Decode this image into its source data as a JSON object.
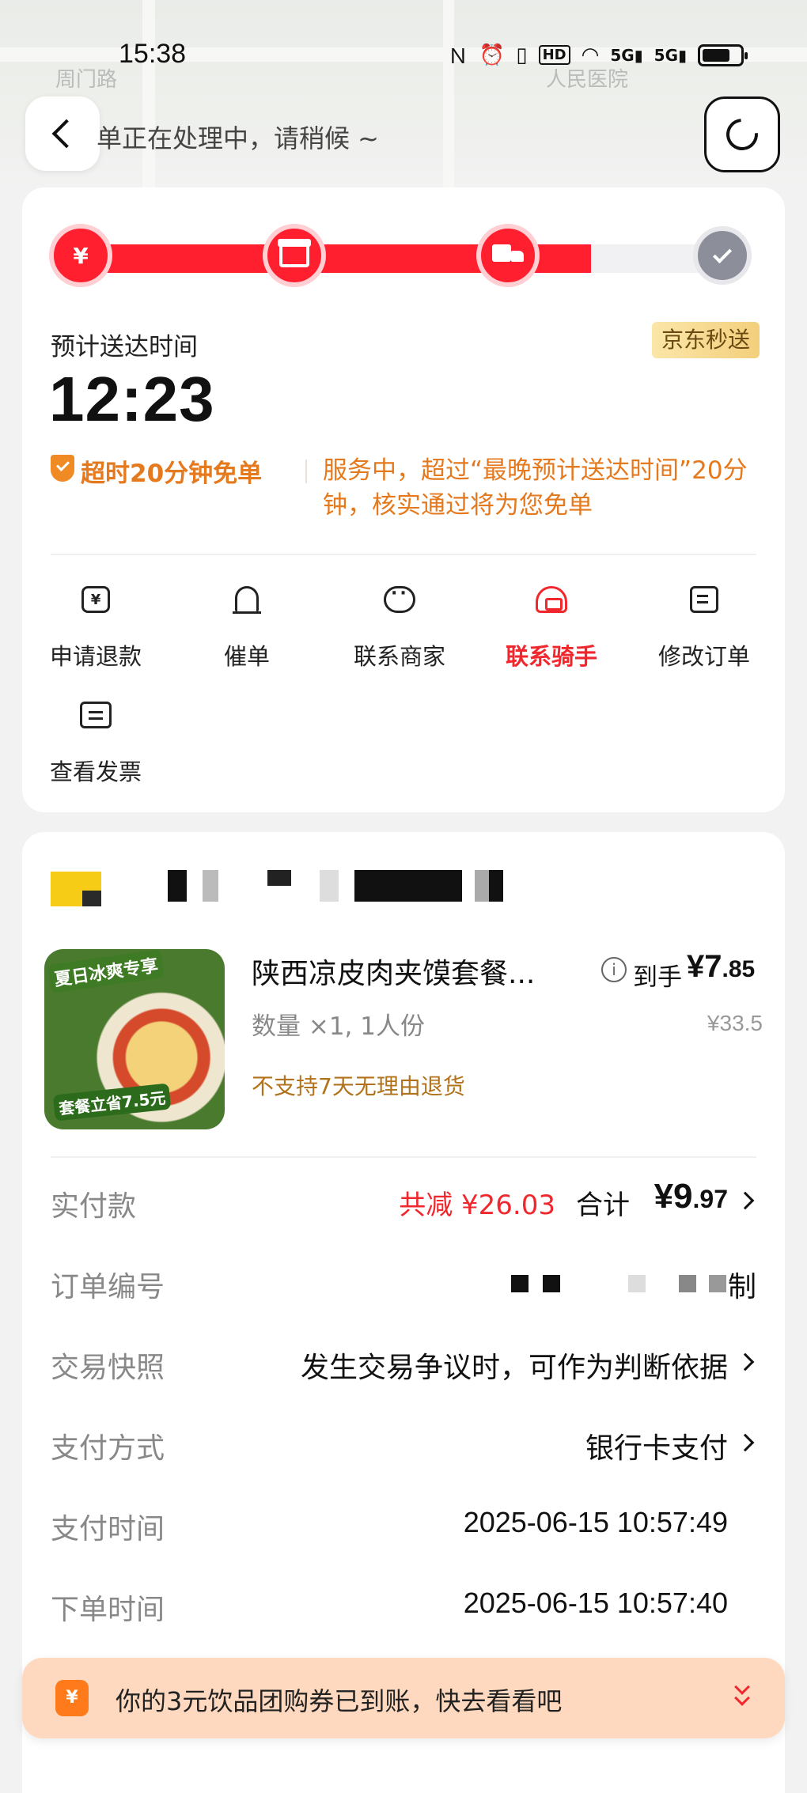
{
  "status_bar": {
    "time": "15:38",
    "icons": [
      "nfc-icon",
      "alarm-icon",
      "vibrate-icon",
      "hd-icon",
      "wifi-icon",
      "signal-5g-icon",
      "signal-5g-icon",
      "battery-icon"
    ]
  },
  "map": {
    "labels": [
      "周门路",
      "人民医院"
    ]
  },
  "header": {
    "processing_text": "单正在处理中，请稍候 ~"
  },
  "progress": {
    "fraction": 0.78,
    "colors": {
      "active": "#ff1f2f",
      "inactive": "#f1f1f3",
      "done": "#8c8f99"
    },
    "first_step_glyph": "¥"
  },
  "delivery": {
    "eta_label": "预计送达时间",
    "eta_time": "12:23",
    "badge": "京东秒送",
    "guarantee_title": "超时20分钟免单",
    "guarantee_desc": "服务中，超过“最晚预计送达时间”20分钟，核实通过将为您免单"
  },
  "actions": [
    {
      "label": "申请退款",
      "icon": "refund-icon"
    },
    {
      "label": "催单",
      "icon": "bell-icon"
    },
    {
      "label": "联系商家",
      "icon": "merchant-chat-icon"
    },
    {
      "label": "联系骑手",
      "icon": "rider-helmet-icon"
    },
    {
      "label": "修改订单",
      "icon": "edit-order-icon"
    },
    {
      "label": "查看发票",
      "icon": "invoice-icon"
    }
  ],
  "product": {
    "name": "陕西凉皮肉夹馍套餐...",
    "qty": "数量 ×1, 1人份",
    "no_refund": "不支持7天无理由退货",
    "price_label": "到手",
    "price_int": "¥7",
    "price_dec": ".85",
    "orig_price": "¥33.5",
    "image_tags": [
      "夏日冰爽专享",
      "套餐立省7.5元"
    ]
  },
  "details": {
    "paid_label": "实付款",
    "discount": "共减 ¥26.03",
    "total_label": "合计",
    "total_int": "¥9",
    "total_dec": ".97",
    "order_no_label": "订单编号",
    "order_no_tail": "制",
    "snapshot_label": "交易快照",
    "snapshot_value": "发生交易争议时，可作为判断依据",
    "pay_method_label": "支付方式",
    "pay_method_value": "银行卡支付",
    "pay_time_label": "支付时间",
    "pay_time_value": "2025-06-15 10:57:49",
    "order_time_label": "下单时间",
    "order_time_value": "2025-06-15 10:57:40"
  },
  "banner": {
    "text": "你的3元饮品团购券已到账，快去看看吧",
    "icon_glyph": "¥"
  }
}
